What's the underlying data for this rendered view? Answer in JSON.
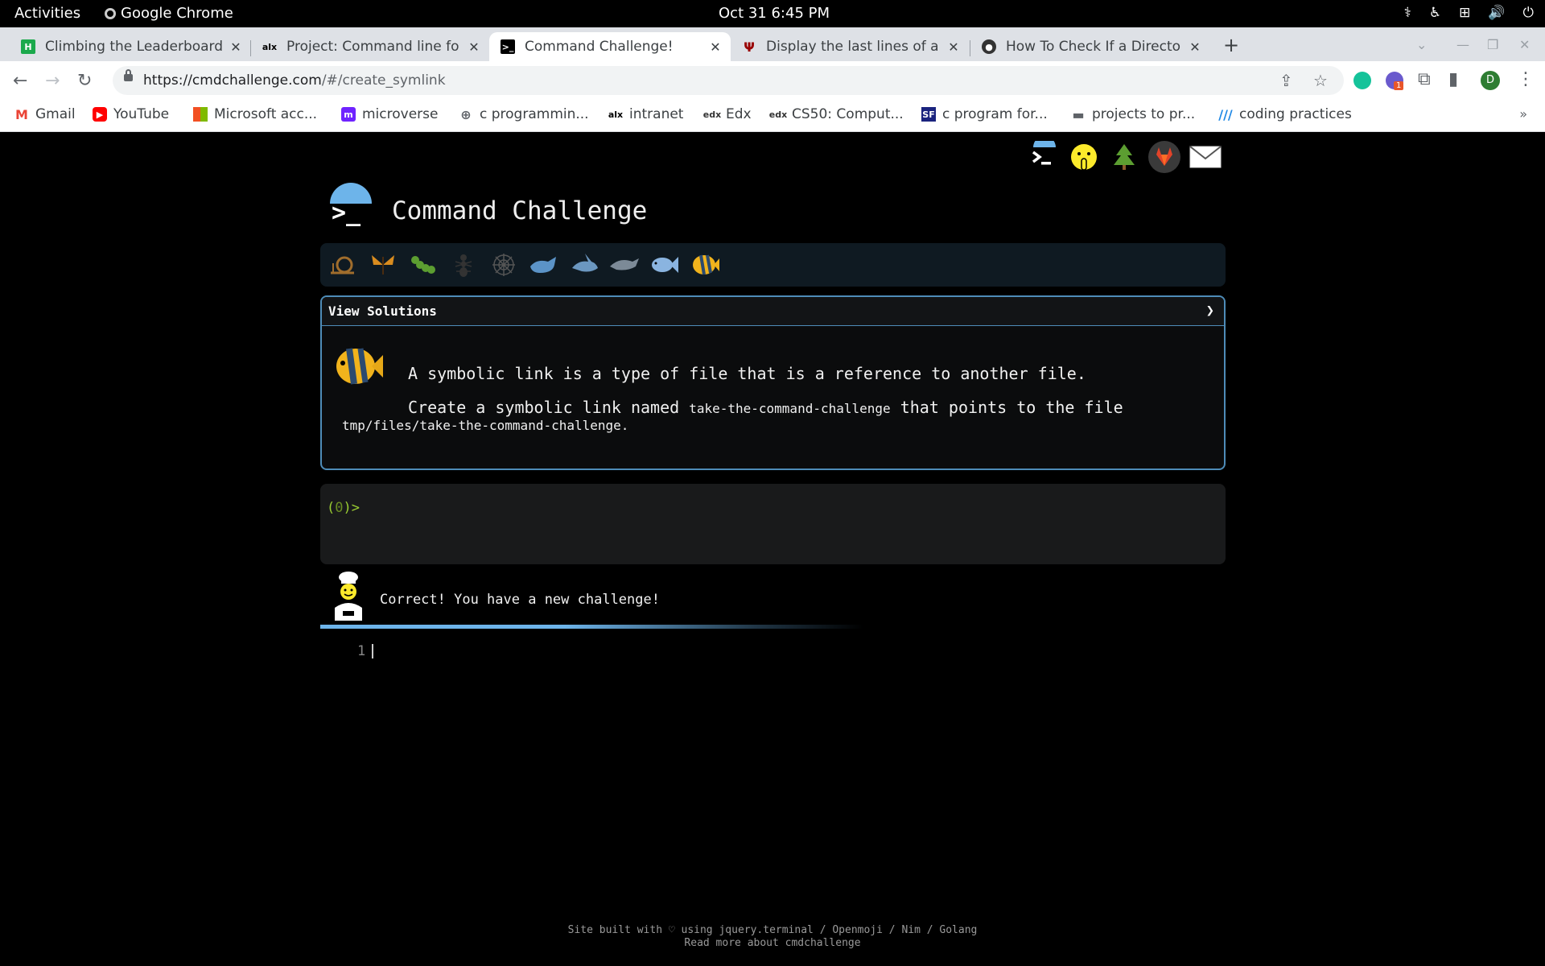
{
  "system_bar": {
    "activities": "Activities",
    "app_name": "Google Chrome",
    "clock": "Oct 31  6:45 PM"
  },
  "tabs": [
    {
      "title": "Climbing the Leaderboard",
      "favicon": "hackerrank-icon",
      "active": false
    },
    {
      "title": "Project: Command line for",
      "favicon": "alx-icon",
      "active": false
    },
    {
      "title": "Command Challenge!",
      "favicon": "terminal-icon",
      "active": true
    },
    {
      "title": "Display the last lines of a f",
      "favicon": "iu-icon",
      "active": false
    },
    {
      "title": "How To Check If a Directo",
      "favicon": "linuxize-icon",
      "active": false
    }
  ],
  "address_bar": {
    "host": "https://cmdchallenge.com",
    "path": "/#/create_symlink"
  },
  "extensions": {
    "badge_count": "1",
    "profile_initial": "D"
  },
  "bookmarks": [
    {
      "label": "Gmail",
      "icon": "gmail-icon"
    },
    {
      "label": "YouTube",
      "icon": "youtube-icon"
    },
    {
      "label": "Microsoft acc...",
      "icon": "microsoft-icon"
    },
    {
      "label": "microverse",
      "icon": "microverse-icon"
    },
    {
      "label": "c programmin...",
      "icon": "globe-icon"
    },
    {
      "label": "intranet",
      "icon": "alx-icon"
    },
    {
      "label": "Edx",
      "icon": "edx-icon"
    },
    {
      "label": "CS50: Comput...",
      "icon": "edx-icon"
    },
    {
      "label": "c program for...",
      "icon": "sf-icon"
    },
    {
      "label": "projects to pr...",
      "icon": "folder-icon"
    },
    {
      "label": "coding practices",
      "icon": "slashes-icon"
    }
  ],
  "site": {
    "title": "Command Challenge",
    "header_icons": [
      "terminal-icon",
      "shushing-face-icon",
      "tree-icon",
      "gitlab-icon",
      "mail-icon"
    ],
    "levels": [
      "snail-icon",
      "butterfly-icon",
      "caterpillar-icon",
      "ant-icon",
      "spider-web-icon",
      "whale-icon",
      "shark-icon",
      "dolphin-icon",
      "fish-icon",
      "tropical-fish-icon"
    ]
  },
  "challenge": {
    "view_solutions": "View Solutions",
    "chevron": "❯",
    "line1": "A symbolic link is a type of file that is a reference to another file.",
    "line2_prefix": "Create a symbolic link named",
    "link_name": "take-the-command-challenge",
    "line2_suffix": "that points to the file",
    "target_path": "tmp/files/take-the-command-challenge",
    "period": "."
  },
  "terminal": {
    "prompt_open": "(",
    "prompt_count": "0",
    "prompt_close": ")>"
  },
  "result": {
    "message": "Correct! You have a new challenge!"
  },
  "editor": {
    "line_number": "1"
  },
  "footer": {
    "line1": "Site built with ♡ using jquery.terminal / Openmoji / Nim / Golang",
    "line2": "Read more about cmdchallenge"
  },
  "colors": {
    "accent": "#6db4ea",
    "prompt_green": "#9acd32",
    "challenge_border": "#4e8cb8"
  }
}
